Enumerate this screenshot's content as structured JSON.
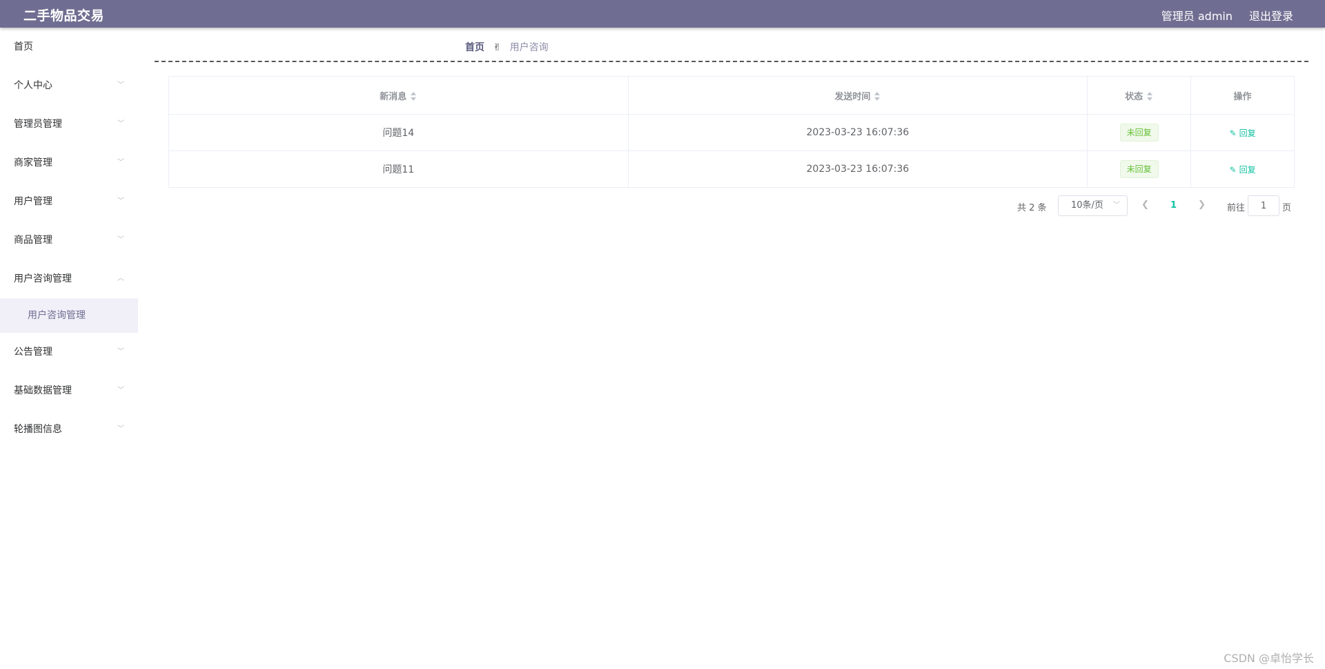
{
  "header": {
    "title": "二手物品交易",
    "user": "管理员 admin",
    "logout": "退出登录"
  },
  "sidebar": {
    "home": "首页",
    "items": [
      {
        "label": "个人中心"
      },
      {
        "label": "管理员管理"
      },
      {
        "label": "商家管理"
      },
      {
        "label": "用户管理"
      },
      {
        "label": "商品管理"
      },
      {
        "label": "用户咨询管理"
      },
      {
        "label": "公告管理"
      },
      {
        "label": "基础数据管理"
      },
      {
        "label": "轮播图信息"
      }
    ],
    "open_submenu": "用户咨询管理"
  },
  "breadcrumb": {
    "home": "首页",
    "separator": "✌",
    "current": "用户咨询"
  },
  "table": {
    "headers": [
      "新消息",
      "发送时间",
      "状态",
      "操作"
    ],
    "rows": [
      {
        "message": "问题14",
        "time": "2023-03-23 16:07:36",
        "status": "未回复",
        "action": "回复"
      },
      {
        "message": "问题11",
        "time": "2023-03-23 16:07:36",
        "status": "未回复",
        "action": "回复"
      }
    ]
  },
  "pagination": {
    "total": "共 2 条",
    "page_size": "10条/页",
    "current_page": "1",
    "goto_label": "前往",
    "goto_value": "1",
    "page_unit": "页"
  },
  "watermark": "CSDN @卓怡学长",
  "colors": {
    "header_bg": "#6f6d91",
    "accent": "#13c2a3",
    "status_tag": "#67c23a"
  }
}
